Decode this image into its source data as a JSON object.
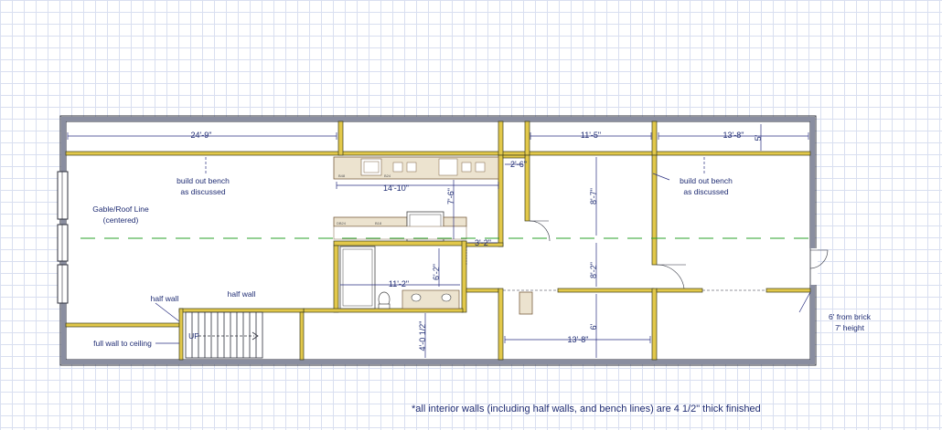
{
  "dimensions": {
    "d1": "24'-9\"",
    "d2": "11'-5\"",
    "d3": "13'-8\"",
    "d4": "14'-10\"",
    "d5": "2'-6\"",
    "d6": "7'-6\"",
    "d7": "8'-7\"",
    "d8": "8'-2\"",
    "d9": "11'-2\"",
    "d10": "6'-2\"",
    "d11": "3'-2\"",
    "d12": "4'-0 1/2\"",
    "d13": "13'-8\"",
    "d14": "6'",
    "d15": "5'"
  },
  "notes": {
    "bench_left_1": "build out bench",
    "bench_left_2": "as discussed",
    "bench_right_1": "build out bench",
    "bench_right_2": "as discussed",
    "gable_1": "Gable/Roof Line",
    "gable_2": "(centered)",
    "half_wall_1": "half wall",
    "half_wall_2": "half wall",
    "full_wall": "full wall to ceiling",
    "stair_up": "UP",
    "brick_1": "6' from brick",
    "brick_2": "7' height"
  },
  "footnote": "*all interior walls (including half walls, and bench lines) are 4 1/2\" thick finished",
  "colors": {
    "wall_outer": "#8a8ea0",
    "wall_outer_edge": "#2b2e3a",
    "wall_interior": "#e2c84a",
    "dim_line": "#2a2f80",
    "gable_line": "#2aa02a"
  }
}
